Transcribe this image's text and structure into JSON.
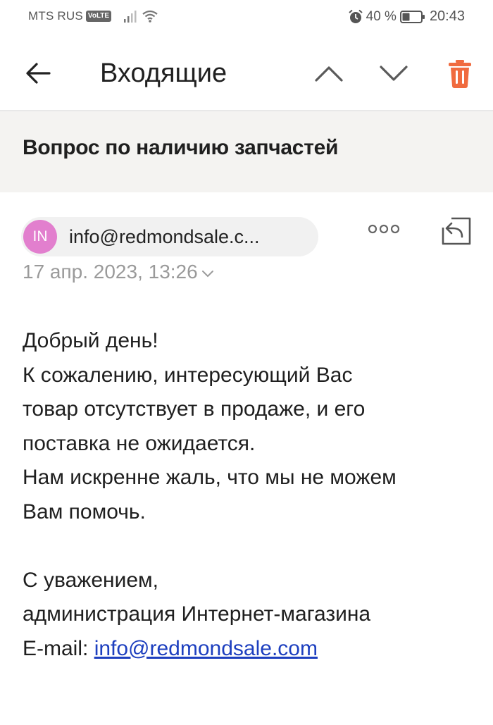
{
  "status_bar": {
    "carrier": "MTS RUS",
    "volte": "VoLTE",
    "battery_percent": "40 %",
    "battery_level": 0.4,
    "time": "20:43"
  },
  "toolbar": {
    "title": "Входящие",
    "back_icon": "arrow-left-icon",
    "prev_icon": "chevron-up-icon",
    "next_icon": "chevron-down-icon",
    "delete_icon": "trash-icon",
    "delete_color": "#f06b3f"
  },
  "message": {
    "subject": "Вопрос по наличию запчастей",
    "sender": {
      "initials": "IN",
      "email": "info@redmondsale.c...",
      "avatar_color": "#e27fce"
    },
    "date": "17 апр. 2023, 13:26",
    "body": {
      "lines": [
        "Добрый день!",
        "К сожалению, интересующий Вас",
        "товар отсутствует в продаже, и его",
        "поставка не ожидается.",
        "Нам искренне жаль, что мы не можем",
        "Вам помочь."
      ],
      "signature_lines": [
        "С уважением,",
        "администрация Интернет-магазина"
      ],
      "email_label": "E-mail: ",
      "email_link": "info@redmondsale.com"
    }
  }
}
